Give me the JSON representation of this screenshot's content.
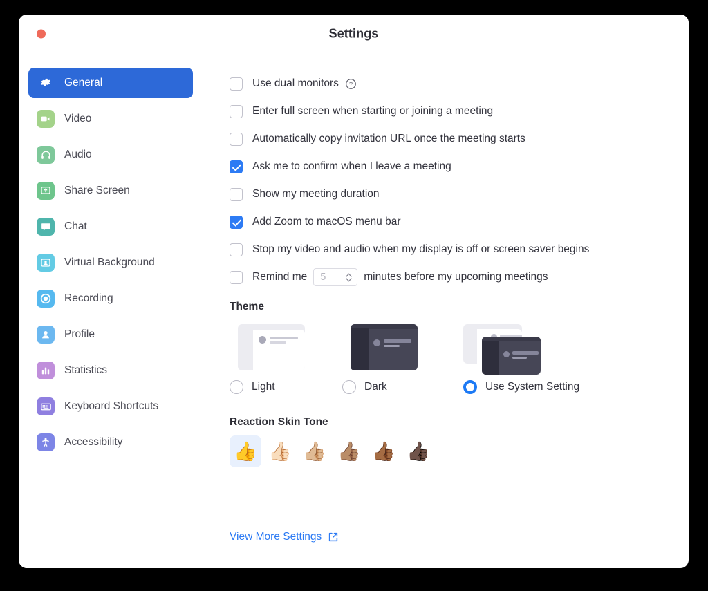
{
  "window": {
    "title": "Settings",
    "close_label": "Close"
  },
  "sidebar": {
    "items": [
      {
        "label": "General",
        "icon": "gear-icon",
        "active": true,
        "icon_bg": "#2d69d8"
      },
      {
        "label": "Video",
        "icon": "video-camera-icon",
        "active": false,
        "icon_bg": "#a4d38a"
      },
      {
        "label": "Audio",
        "icon": "headphones-icon",
        "active": false,
        "icon_bg": "#7ec89a"
      },
      {
        "label": "Share Screen",
        "icon": "share-screen-icon",
        "active": false,
        "icon_bg": "#6ec58c"
      },
      {
        "label": "Chat",
        "icon": "chat-bubble-icon",
        "active": false,
        "icon_bg": "#4fb5ac"
      },
      {
        "label": "Virtual Background",
        "icon": "virtual-background-icon",
        "active": false,
        "icon_bg": "#63cbe4"
      },
      {
        "label": "Recording",
        "icon": "record-circle-icon",
        "active": false,
        "icon_bg": "#56b9ef"
      },
      {
        "label": "Profile",
        "icon": "person-icon",
        "active": false,
        "icon_bg": "#6cb8f0"
      },
      {
        "label": "Statistics",
        "icon": "bar-chart-icon",
        "active": false,
        "icon_bg": "#c08fdb"
      },
      {
        "label": "Keyboard Shortcuts",
        "icon": "keyboard-icon",
        "active": false,
        "icon_bg": "#8f7fe0"
      },
      {
        "label": "Accessibility",
        "icon": "accessibility-icon",
        "active": false,
        "icon_bg": "#7d85e6"
      }
    ]
  },
  "main": {
    "checkboxes": [
      {
        "label": "Use dual monitors",
        "checked": false,
        "help": true
      },
      {
        "label": "Enter full screen when starting or joining a meeting",
        "checked": false,
        "help": false
      },
      {
        "label": "Automatically copy invitation URL once the meeting starts",
        "checked": false,
        "help": false
      },
      {
        "label": "Ask me to confirm when I leave a meeting",
        "checked": true,
        "help": false
      },
      {
        "label": "Show my meeting duration",
        "checked": false,
        "help": false
      },
      {
        "label": "Add Zoom to macOS menu bar",
        "checked": true,
        "help": false
      },
      {
        "label": "Stop my video and audio when my display is off or screen saver begins",
        "checked": false,
        "help": false
      }
    ],
    "remind": {
      "checked": false,
      "prefix": "Remind me",
      "value": "5",
      "suffix": "minutes before my upcoming meetings"
    },
    "theme": {
      "heading": "Theme",
      "selected": "Use System Setting",
      "options": [
        {
          "label": "Light",
          "selected": false,
          "preview": "light-window-preview"
        },
        {
          "label": "Dark",
          "selected": false,
          "preview": "dark-window-preview"
        },
        {
          "label": "Use System Setting",
          "selected": true,
          "preview": "system-window-preview"
        }
      ]
    },
    "skin_tone": {
      "heading": "Reaction Skin Tone",
      "selected_index": 0,
      "options": [
        {
          "name": "default-yellow",
          "emoji": "👍"
        },
        {
          "name": "light-skin-tone",
          "emoji": "👍🏻"
        },
        {
          "name": "medium-light-skin-tone",
          "emoji": "👍🏼"
        },
        {
          "name": "medium-skin-tone",
          "emoji": "👍🏽"
        },
        {
          "name": "medium-dark-skin-tone",
          "emoji": "👍🏾"
        },
        {
          "name": "dark-skin-tone",
          "emoji": "👍🏿"
        }
      ]
    },
    "view_more_settings": "View More Settings"
  },
  "colors": {
    "accent": "#2d7bf4",
    "sidebar_active": "#2d69d8",
    "close_button": "#ef6a5a",
    "link": "#2d7bf4"
  }
}
